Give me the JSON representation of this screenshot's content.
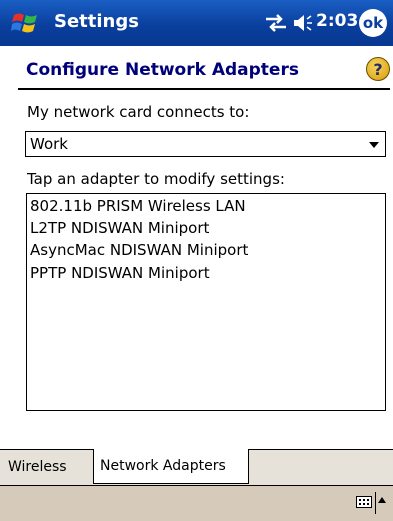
{
  "titlebar": {
    "app_title": "Settings",
    "clock": "2:03",
    "ok_label": "ok"
  },
  "header": {
    "title": "Configure Network Adapters",
    "help_symbol": "?"
  },
  "network_card": {
    "label": "My network card connects to:",
    "selected": "Work"
  },
  "adapters": {
    "label": "Tap an adapter to modify settings:",
    "items": [
      "802.11b PRISM Wireless LAN",
      "L2TP NDISWAN Miniport",
      "AsyncMac NDISWAN Miniport",
      "PPTP NDISWAN Miniport"
    ]
  },
  "tabs": [
    {
      "label": "Wireless",
      "active": false
    },
    {
      "label": "Network Adapters",
      "active": true
    }
  ],
  "colors": {
    "titlebar": "#0a3f9e",
    "title_text": "#00007a",
    "tab_bg": "#e7e2d9",
    "cmdbar_bg": "#d6cbbb"
  }
}
